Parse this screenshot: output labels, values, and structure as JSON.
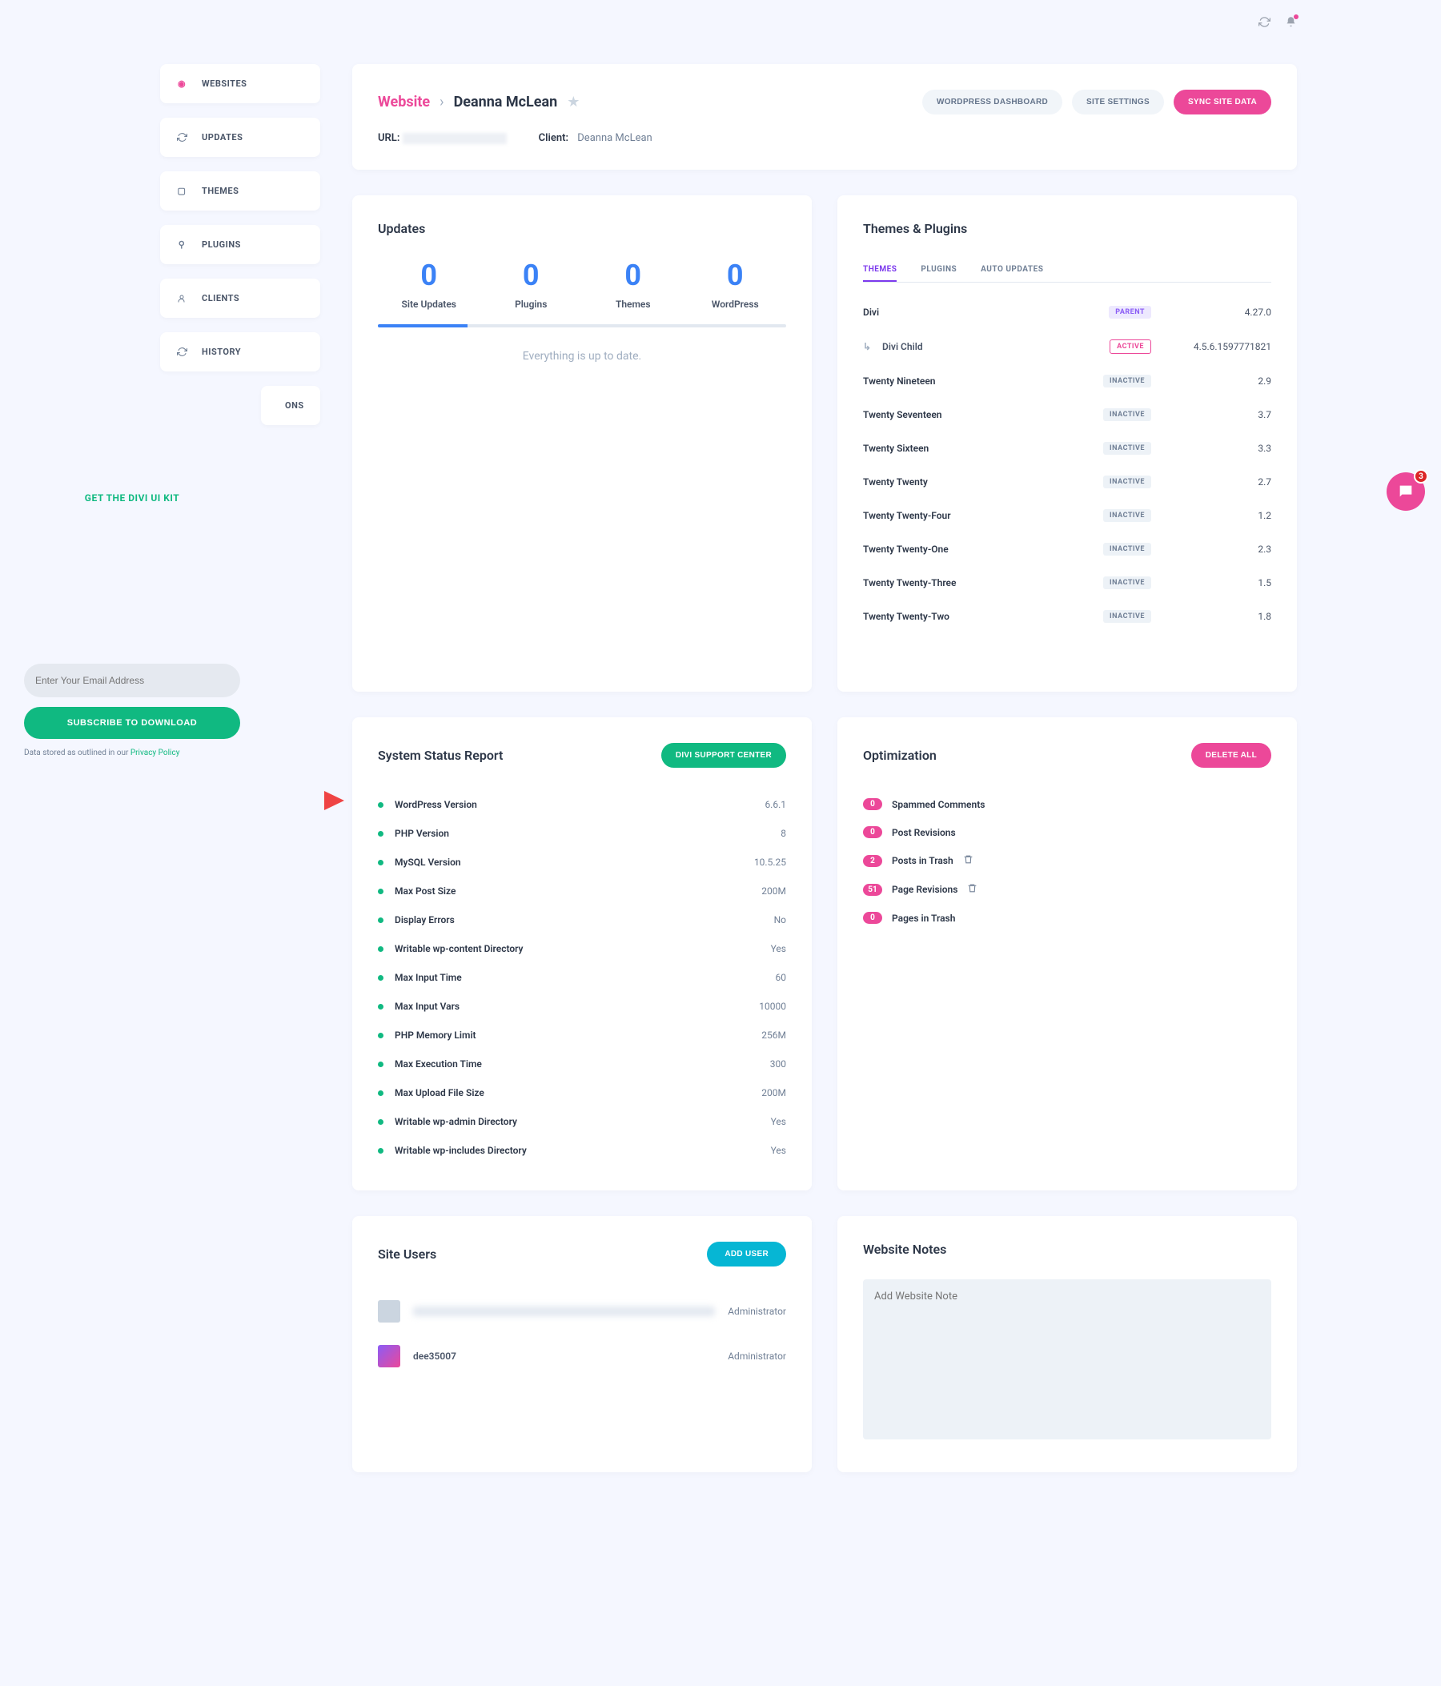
{
  "topbar": {
    "notif_count": 1
  },
  "sidebar": {
    "items": [
      {
        "label": "WEBSITES",
        "icon": "globe-icon",
        "active": true
      },
      {
        "label": "UPDATES",
        "icon": "refresh-icon"
      },
      {
        "label": "THEMES",
        "icon": "window-icon"
      },
      {
        "label": "PLUGINS",
        "icon": "plug-icon"
      },
      {
        "label": "CLIENTS",
        "icon": "user-icon"
      },
      {
        "label": "HISTORY",
        "icon": "refresh-icon"
      },
      {
        "label": "ONS",
        "icon": ""
      }
    ]
  },
  "promo": {
    "title": "GET THE DIVI UI KIT",
    "placeholder": "Enter Your Email Address",
    "button": "SUBSCRIBE TO DOWNLOAD",
    "note_prefix": "Data stored as outlined in our ",
    "note_link": "Privacy Policy"
  },
  "header": {
    "root": "Website",
    "name": "Deanna McLean",
    "buttons": {
      "wp": "WORDPRESS DASHBOARD",
      "settings": "SITE SETTINGS",
      "sync": "SYNC SITE DATA"
    },
    "url_label": "URL:",
    "client_label": "Client:",
    "client_value": "Deanna McLean"
  },
  "updates": {
    "title": "Updates",
    "cells": [
      {
        "num": "0",
        "label": "Site Updates"
      },
      {
        "num": "0",
        "label": "Plugins"
      },
      {
        "num": "0",
        "label": "Themes"
      },
      {
        "num": "0",
        "label": "WordPress"
      }
    ],
    "message": "Everything is up to date."
  },
  "themes_plugins": {
    "title": "Themes & Plugins",
    "tabs": {
      "themes": "THEMES",
      "plugins": "PLUGINS",
      "auto": "AUTO UPDATES"
    },
    "rows": [
      {
        "name": "Divi",
        "status": "PARENT",
        "status_class": "badge-parent",
        "version": "4.27.0"
      },
      {
        "name": "Divi Child",
        "status": "ACTIVE",
        "status_class": "badge-active",
        "version": "4.5.6.1597771821",
        "child": true
      },
      {
        "name": "Twenty Nineteen",
        "status": "INACTIVE",
        "status_class": "badge-inactive",
        "version": "2.9"
      },
      {
        "name": "Twenty Seventeen",
        "status": "INACTIVE",
        "status_class": "badge-inactive",
        "version": "3.7"
      },
      {
        "name": "Twenty Sixteen",
        "status": "INACTIVE",
        "status_class": "badge-inactive",
        "version": "3.3"
      },
      {
        "name": "Twenty Twenty",
        "status": "INACTIVE",
        "status_class": "badge-inactive",
        "version": "2.7"
      },
      {
        "name": "Twenty Twenty-Four",
        "status": "INACTIVE",
        "status_class": "badge-inactive",
        "version": "1.2"
      },
      {
        "name": "Twenty Twenty-One",
        "status": "INACTIVE",
        "status_class": "badge-inactive",
        "version": "2.3"
      },
      {
        "name": "Twenty Twenty-Three",
        "status": "INACTIVE",
        "status_class": "badge-inactive",
        "version": "1.5"
      },
      {
        "name": "Twenty Twenty-Two",
        "status": "INACTIVE",
        "status_class": "badge-inactive",
        "version": "1.8"
      }
    ]
  },
  "system_status": {
    "title": "System Status Report",
    "button": "DIVI SUPPORT CENTER",
    "rows": [
      {
        "key": "WordPress Version",
        "val": "6.6.1"
      },
      {
        "key": "PHP Version",
        "val": "8"
      },
      {
        "key": "MySQL Version",
        "val": "10.5.25"
      },
      {
        "key": "Max Post Size",
        "val": "200M"
      },
      {
        "key": "Display Errors",
        "val": "No"
      },
      {
        "key": "Writable wp-content Directory",
        "val": "Yes"
      },
      {
        "key": "Max Input Time",
        "val": "60"
      },
      {
        "key": "Max Input Vars",
        "val": "10000"
      },
      {
        "key": "PHP Memory Limit",
        "val": "256M"
      },
      {
        "key": "Max Execution Time",
        "val": "300"
      },
      {
        "key": "Max Upload File Size",
        "val": "200M"
      },
      {
        "key": "Writable wp-admin Directory",
        "val": "Yes"
      },
      {
        "key": "Writable wp-includes Directory",
        "val": "Yes"
      }
    ]
  },
  "optimization": {
    "title": "Optimization",
    "button": "DELETE ALL",
    "rows": [
      {
        "count": "0",
        "label": "Spammed Comments"
      },
      {
        "count": "0",
        "label": "Post Revisions"
      },
      {
        "count": "2",
        "label": "Posts in Trash",
        "trash": true
      },
      {
        "count": "51",
        "label": "Page Revisions",
        "trash": true
      },
      {
        "count": "0",
        "label": "Pages in Trash"
      }
    ]
  },
  "site_users": {
    "title": "Site Users",
    "button": "ADD USER",
    "rows": [
      {
        "name": "",
        "role": "Administrator",
        "blurred": true,
        "photo": false
      },
      {
        "name": "dee35007",
        "role": "Administrator",
        "blurred": false,
        "photo": true
      }
    ]
  },
  "notes": {
    "title": "Website Notes",
    "placeholder": "Add Website Note"
  },
  "chat": {
    "badge": "3"
  }
}
